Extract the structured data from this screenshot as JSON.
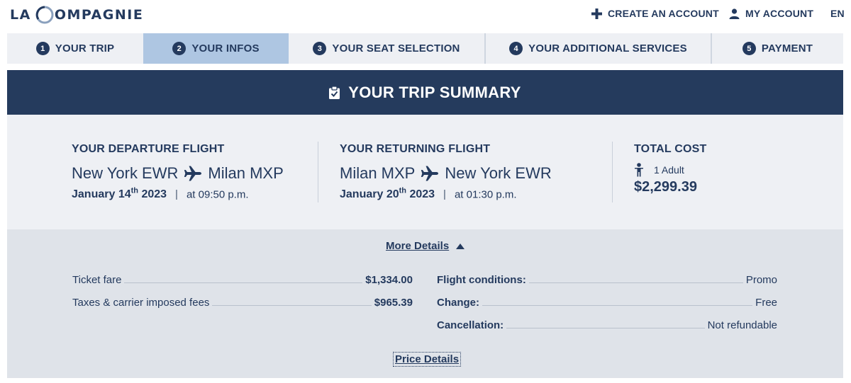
{
  "brand": {
    "logo_prefix": "LA",
    "logo_c": "C",
    "logo_rest": "OMPAGNIE"
  },
  "header": {
    "create_account": "CREATE AN ACCOUNT",
    "my_account": "MY ACCOUNT",
    "language": "EN"
  },
  "steps": [
    {
      "num": "1",
      "label": "YOUR TRIP"
    },
    {
      "num": "2",
      "label": "YOUR INFOS"
    },
    {
      "num": "3",
      "label": "YOUR SEAT SELECTION"
    },
    {
      "num": "4",
      "label": "YOUR ADDITIONAL SERVICES"
    },
    {
      "num": "5",
      "label": "PAYMENT"
    }
  ],
  "active_step": "2",
  "summary": {
    "title": "YOUR TRIP SUMMARY",
    "departure": {
      "heading": "YOUR DEPARTURE FLIGHT",
      "from": "New York EWR",
      "to": "Milan MXP",
      "date_main": "January 14",
      "date_sup": "th",
      "date_year": " 2023",
      "separator": "|",
      "time": "at 09:50 p.m."
    },
    "returning": {
      "heading": "YOUR RETURNING FLIGHT",
      "from": "Milan MXP",
      "to": "New York EWR",
      "date_main": "January 20",
      "date_sup": "th",
      "date_year": " 2023",
      "separator": "|",
      "time": "at 01:30 p.m."
    },
    "total": {
      "heading": "TOTAL COST",
      "passengers": "1 Adult",
      "amount": "$2,299.39"
    }
  },
  "details": {
    "more_details": "More Details",
    "fares": [
      {
        "label": "Ticket fare",
        "value": "$1,334.00"
      },
      {
        "label": "Taxes & carrier imposed fees",
        "value": "$965.39"
      }
    ],
    "conditions": [
      {
        "label": "Flight conditions:",
        "value": "Promo"
      },
      {
        "label": "Change:",
        "value": "Free"
      },
      {
        "label": "Cancellation:",
        "value": "Not refundable"
      }
    ],
    "price_details": "Price Details"
  },
  "icons": [
    "plus-icon",
    "user-icon",
    "clipboard-check-icon",
    "plane-icon",
    "person-icon",
    "caret-up-icon"
  ],
  "colors": {
    "navy": "#253b5d",
    "active_step": "#aec6e2",
    "panel": "#eef0f4",
    "details_panel": "#dfe3e9"
  }
}
